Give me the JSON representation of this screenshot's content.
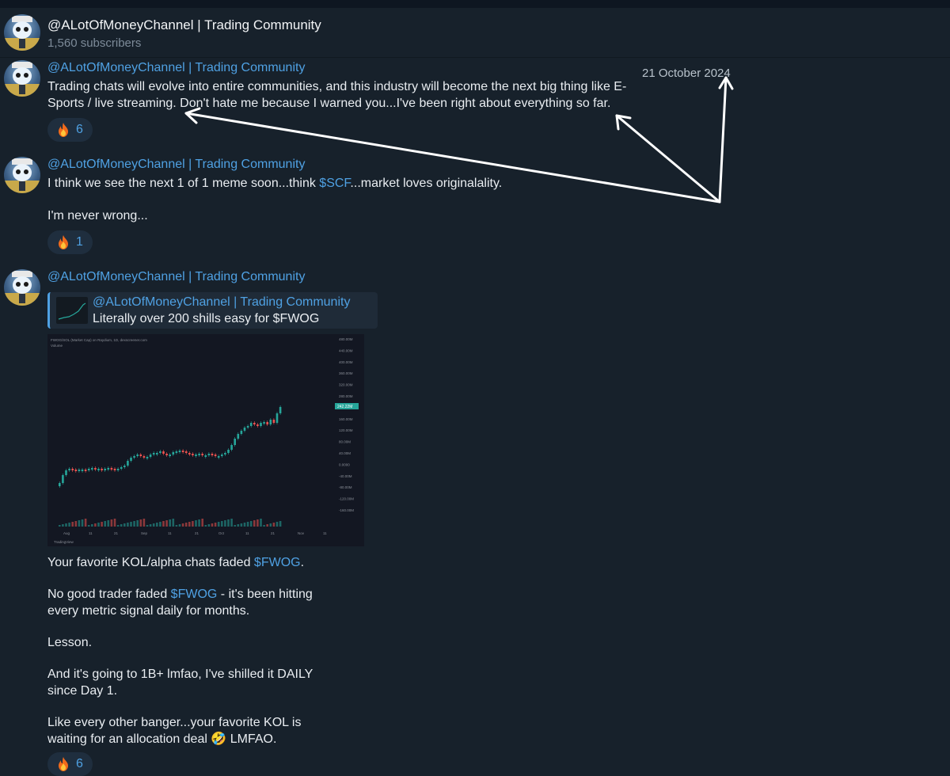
{
  "channel": {
    "title": "@ALotOfMoneyChannel | Trading Community",
    "subscribers": "1,560 subscribers"
  },
  "annotation": {
    "date": "21 October 2024"
  },
  "messages": [
    {
      "sender": "@ALotOfMoneyChannel | Trading Community",
      "text_line1": "Trading chats will evolve into entire communities, and this industry will become the next big thing like E-",
      "text_line2": "Sports / live streaming. Don't hate me because I warned you...I've been right about everything so far.",
      "reaction_count": "6"
    },
    {
      "sender": "@ALotOfMoneyChannel | Trading Community",
      "text_pre": "I think we see the next 1 of 1 meme soon...think ",
      "ticker": "$SCF",
      "text_post": "...market loves originalality.",
      "text_line2": "I'm never wrong...",
      "reaction_count": "1"
    },
    {
      "sender": "@ALotOfMoneyChannel | Trading Community",
      "quote": {
        "sender": "@ALotOfMoneyChannel | Trading Community",
        "text": "Literally over 200 shills easy for $FWOG"
      },
      "p1_pre": "Your favorite KOL/alpha chats faded ",
      "p1_ticker": "$FWOG",
      "p1_post": ".",
      "p2_ticker": "$FWOG",
      "p2_post": " - it's been hitting",
      "p2_pre": "No good trader faded ",
      "p2_line2": "every metric signal daily for months.",
      "p3": "Lesson.",
      "p4_line1": "And it's going to 1B+ lmfao, I've shilled it DAILY",
      "p4_line2": "since Day 1.",
      "p5_line1": "Like every other banger...your favorite KOL is",
      "p5_line2_pre": "waiting for an allocation deal ",
      "p5_emoji": "🤣",
      "p5_line2_post": " LMFAO.",
      "reaction_count": "6"
    }
  ],
  "chart_image": {
    "header": "FWOG/SOL (Market Cap) on Raydium, 1D, dexscreener.com",
    "volume_label": "Volume",
    "price_tag": "242.22M",
    "y_ticks": [
      "480.00M",
      "440.00M",
      "400.00M",
      "360.00M",
      "320.00M",
      "280.00M",
      "200.00M",
      "160.00M",
      "120.00M",
      "80.00M",
      "40.00M",
      "0.0000",
      "-40.00M",
      "-80.00M",
      "-120.00M",
      "-160.00M"
    ],
    "x_ticks": [
      "Aug",
      "11",
      "21",
      "Sep",
      "11",
      "21",
      "Oct",
      "11",
      "21",
      "Nov",
      "11"
    ],
    "brand": "TradingView",
    "colors": {
      "up": "#26a69a",
      "down": "#ef5350"
    }
  }
}
